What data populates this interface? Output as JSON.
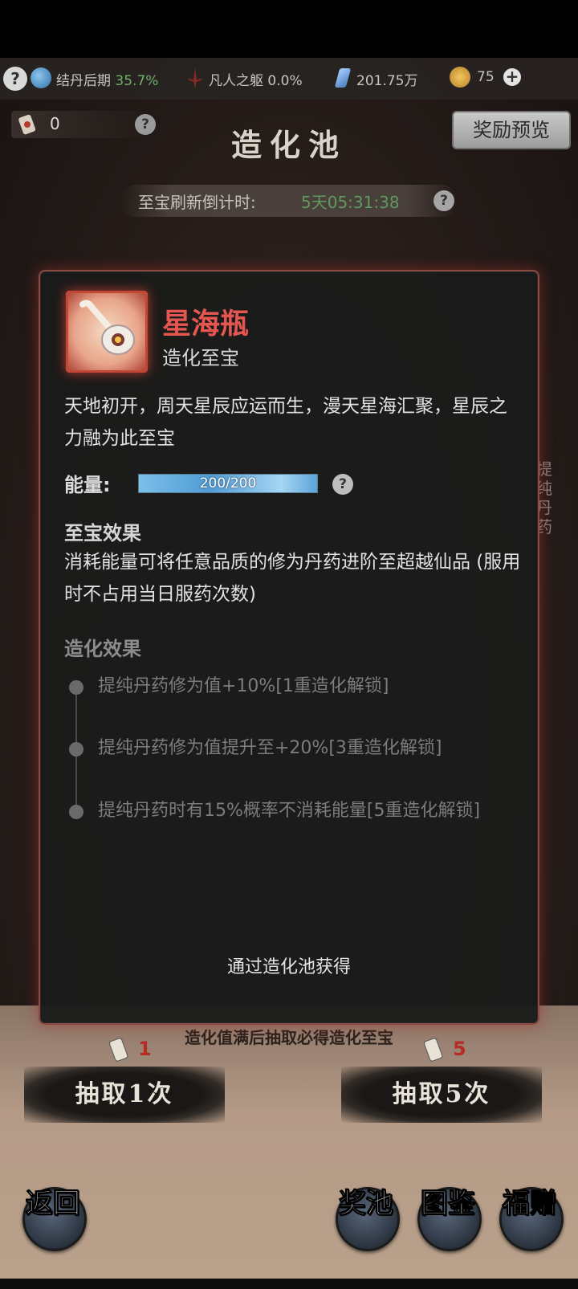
{
  "status_bar": {
    "realm_label": "结丹后期",
    "realm_progress": "35.7%",
    "body_label": "凡人之躯",
    "body_progress": "0.0%",
    "spirit_stones": "201.75万",
    "currency": "75",
    "help_glyph": "?",
    "plus_glyph": "+"
  },
  "header": {
    "ticket_count": "0",
    "title": "造化池",
    "reward_preview_label": "奖励预览",
    "countdown_label": "至宝刷新倒计时:",
    "countdown_time": "5天05:31:38",
    "help_glyph": "?"
  },
  "side_tab": {
    "label": "提纯丹药"
  },
  "modal": {
    "item_name": "星海瓶",
    "item_type": "造化至宝",
    "description": "天地初开，周天星辰应运而生，漫天星海汇聚，星辰之力融为此至宝",
    "energy_label": "能量:",
    "energy_text": "200/200",
    "energy_fraction": 1.0,
    "treasure_effect_heading": "至宝效果",
    "treasure_effect_text": "消耗能量可将任意品质的修为丹药进阶至超越仙品 (服用时不占用当日服药次数)",
    "creation_effect_heading": "造化效果",
    "effects": [
      "提纯丹药修为值+10%[1重造化解锁]",
      "提纯丹药修为值提升至+20%[3重造化解锁]",
      "提纯丹药时有15%概率不消耗能量[5重造化解锁]"
    ],
    "obtain_text": "通过造化池获得"
  },
  "lower": {
    "guarantee_text": "造化值满后抽取必得造化至宝",
    "draw1_cost": "1",
    "draw1_label": "抽取1次",
    "draw5_cost": "5",
    "draw5_label": "抽取5次",
    "back_label": "返回",
    "pool_label": "奖池",
    "codex_label": "图鉴",
    "gift_label": "福赠"
  },
  "colors": {
    "accent_red": "#e4564f",
    "progress_green": "#6fae69",
    "energy_blue": "#4f9cd6"
  }
}
